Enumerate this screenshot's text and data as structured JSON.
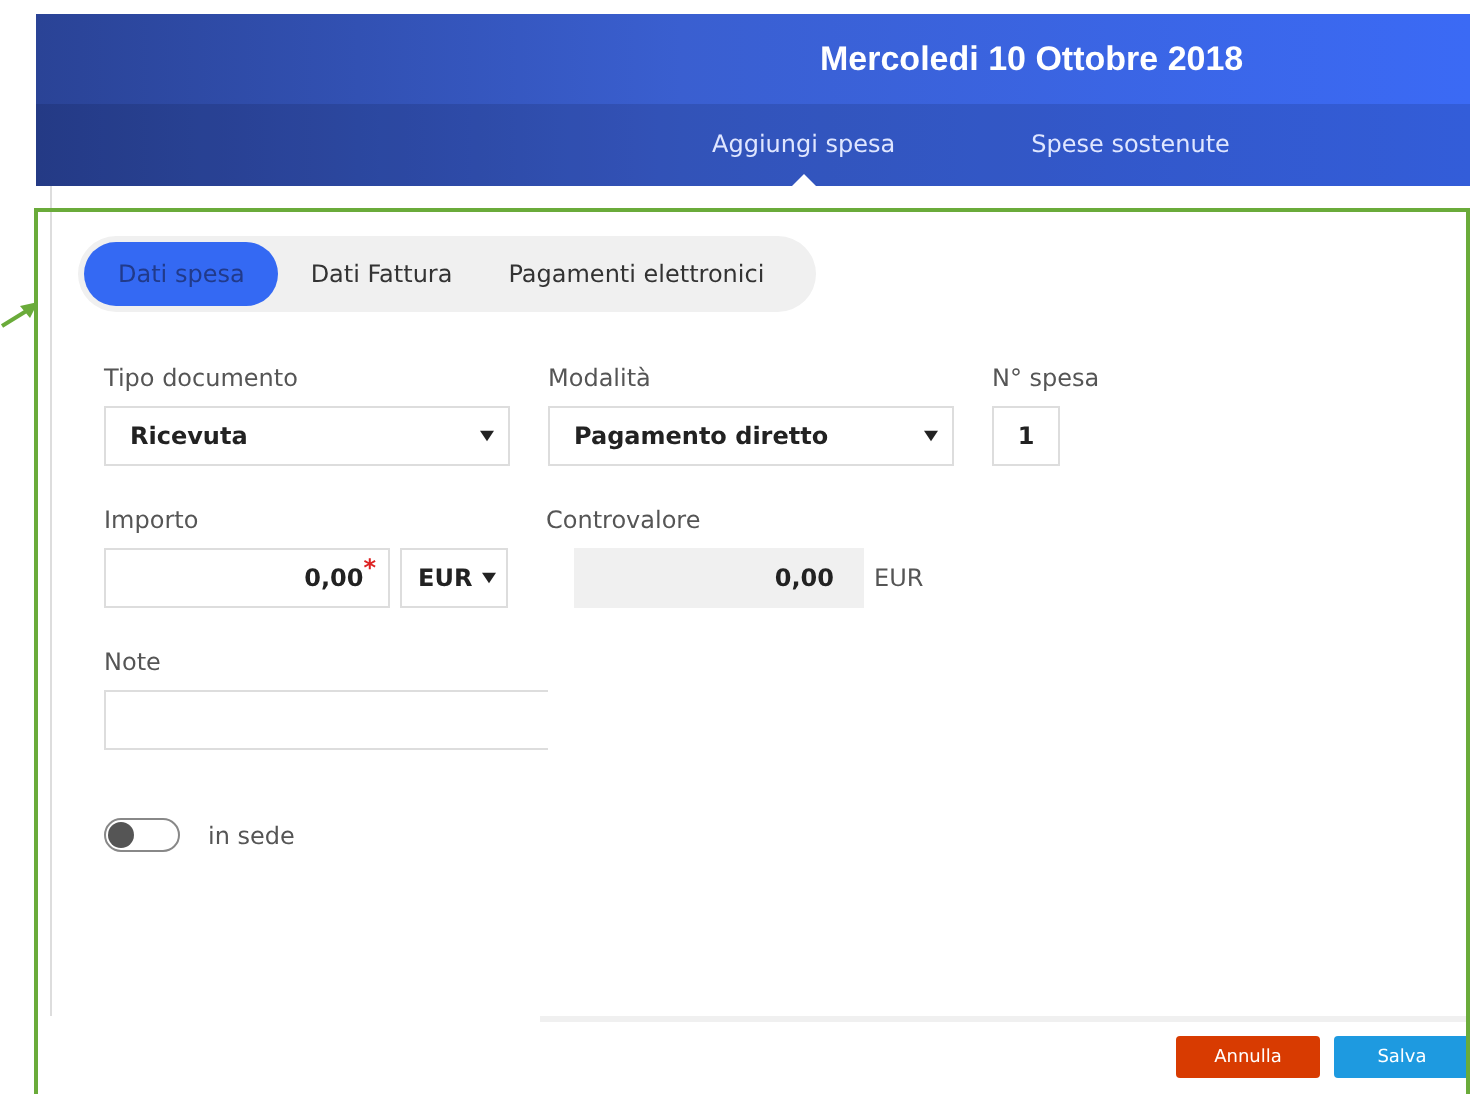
{
  "header": {
    "title": "Mercoledi 10 Ottobre 2018"
  },
  "nav_tabs": [
    {
      "label": "Aggiungi spesa",
      "selected": true
    },
    {
      "label": "Spese sostenute",
      "selected": false
    }
  ],
  "section_tabs": [
    {
      "label": "Dati spesa",
      "selected": true
    },
    {
      "label": "Dati Fattura",
      "selected": false
    },
    {
      "label": "Pagamenti elettronici",
      "selected": false
    }
  ],
  "form": {
    "tipo_documento": {
      "label": "Tipo documento",
      "value": "Ricevuta"
    },
    "modalita": {
      "label": "Modalità",
      "value": "Pagamento diretto"
    },
    "numero_spesa": {
      "label": "N° spesa",
      "value": "1"
    },
    "importo": {
      "label": "Importo",
      "value": "0,00",
      "required_mark": "*",
      "currency": "EUR"
    },
    "controvalore": {
      "label": "Controvalore",
      "value": "0,00",
      "currency": "EUR"
    },
    "note": {
      "label": "Note"
    },
    "in_sede": {
      "label": "in sede",
      "on": false
    }
  },
  "buttons": [
    {
      "label": "Annulla",
      "kind": "cancel"
    },
    {
      "label": "Salva",
      "kind": "save"
    }
  ]
}
